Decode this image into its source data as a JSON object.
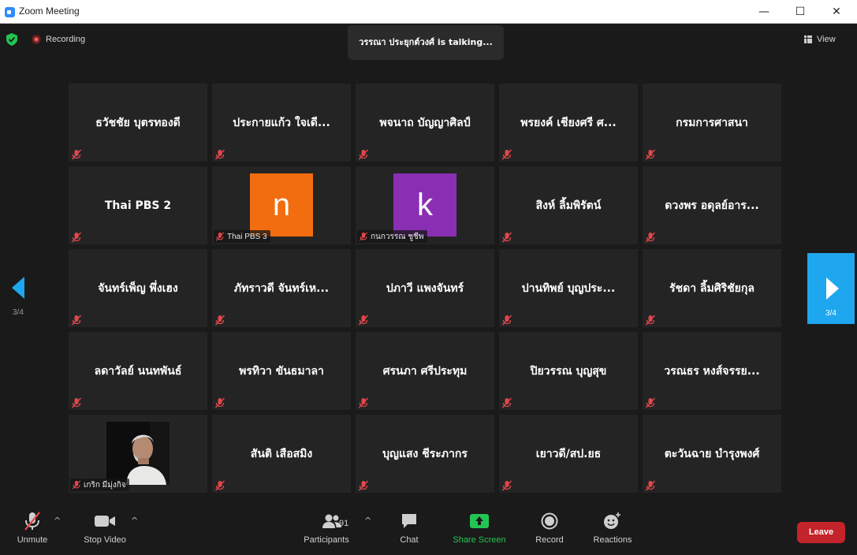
{
  "window": {
    "title": "Zoom Meeting",
    "minimize": "—",
    "maximize": "☐",
    "close": "✕"
  },
  "top_bar": {
    "recording_label": "Recording",
    "talking_text": "วรรณา ประยุกต์วงศ์ is  talking...",
    "view_label": "View"
  },
  "tiles": [
    {
      "name": "ธวัชชัย  บุตรทองดี"
    },
    {
      "name": "ประกายแก้ว ใจเดี..."
    },
    {
      "name": "พจนาถ บัญญาศิลป์"
    },
    {
      "name": "พรยงค์ เชียงศรี ศ..."
    },
    {
      "name": "กรมการศาสนา"
    },
    {
      "name": "Thai PBS 2"
    },
    {
      "label": "Thai PBS 3",
      "avatar_letter": "n",
      "avatar_color": "#f26d0f"
    },
    {
      "label": "กนกวรรณ ชูชีพ",
      "avatar_letter": "k",
      "avatar_color": "#8a2fb3"
    },
    {
      "name": "สิงห์ ลิ้มพิรัตน์"
    },
    {
      "name": "ดวงพร อดุลย์อาร..."
    },
    {
      "name": "จันทร์เพ็ญ พึ่งเฮง"
    },
    {
      "name": "ภัทราวดี จันทร์เห..."
    },
    {
      "name": "ปภาวี แพงจันทร์"
    },
    {
      "name": "ปานทิพย์  บุญประ..."
    },
    {
      "name": "รัชดา ลิ้มศิริชัยกุล"
    },
    {
      "name": "ลดาวัลย์ นนทพันธ์"
    },
    {
      "name": "พรทิวา  ขันธมาลา"
    },
    {
      "name": "ศรนภา ศรีประทุม"
    },
    {
      "name": "ปิยวรรณ บุญสุข"
    },
    {
      "name": "วรณธร หงส์จรรย..."
    },
    {
      "label": "เกริก มีมุ่งกิจ",
      "photo": "person-photo"
    },
    {
      "name": "สันติ เสือสมิง"
    },
    {
      "name": "บุญแสง ชีระภากร"
    },
    {
      "name": "เยาวดี/สป.ยธ"
    },
    {
      "name": "ตะวันฉาย บำรุงพงศ์"
    }
  ],
  "pagination": {
    "left_page": "3/4",
    "right_page": "3/4"
  },
  "toolbar": {
    "unmute": "Unmute",
    "stop_video": "Stop Video",
    "participants": "Participants",
    "participants_count": "91",
    "chat": "Chat",
    "share_screen": "Share Screen",
    "record": "Record",
    "reactions": "Reactions",
    "leave": "Leave",
    "caret": "^"
  },
  "colors": {
    "share_green": "#23c552",
    "leave_red": "#c3232a",
    "nav_blue": "#1ea7ee",
    "mute_red": "#e0474c"
  }
}
